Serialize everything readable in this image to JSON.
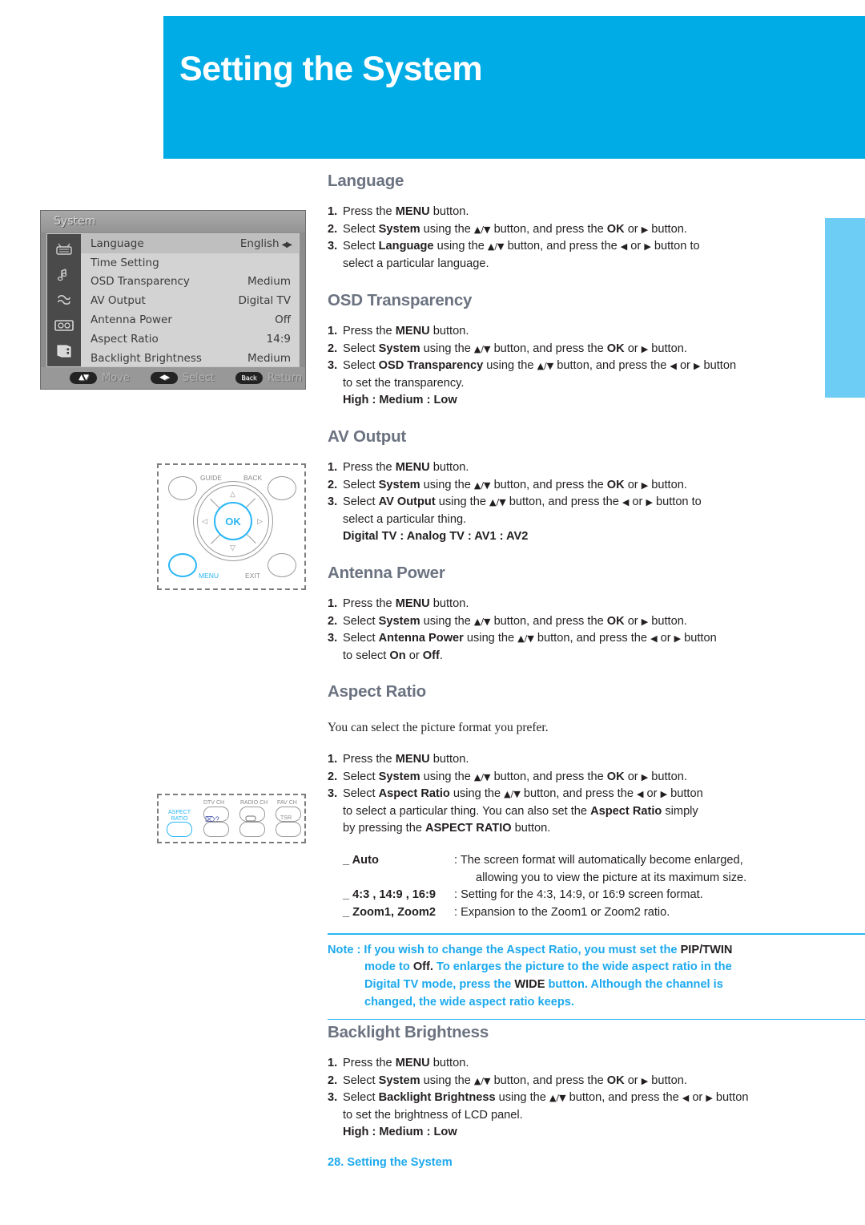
{
  "header": {
    "title": "Setting the System",
    "band_color": "#00ace6",
    "side_tab_color": "#6ecdf5"
  },
  "osd": {
    "title": "System",
    "icons": [
      "tv-icon",
      "music-note-icon",
      "sync-arrows-icon",
      "cassette-icon",
      "system-book-icon"
    ],
    "rows": [
      {
        "label": "Language",
        "value": "English",
        "selected": true,
        "has_arrows": true
      },
      {
        "label": "Time Setting",
        "value": "",
        "selected": false,
        "has_arrows": false
      },
      {
        "label": "OSD Transparency",
        "value": "Medium",
        "selected": false,
        "has_arrows": false
      },
      {
        "label": "AV Output",
        "value": "Digital TV",
        "selected": false,
        "has_arrows": false
      },
      {
        "label": "Antenna Power",
        "value": "Off",
        "selected": false,
        "has_arrows": false
      },
      {
        "label": "Aspect Ratio",
        "value": "14:9",
        "selected": false,
        "has_arrows": false
      },
      {
        "label": "Backlight Brightness",
        "value": "Medium",
        "selected": false,
        "has_arrows": false
      }
    ],
    "footer": [
      {
        "key": "▲▼",
        "label": "Move"
      },
      {
        "key": "◀▶",
        "label": "Select"
      },
      {
        "key": "Back",
        "label": "Return"
      }
    ]
  },
  "remote_dpad": {
    "guide_label": "GUIDE",
    "back_label": "BACK",
    "ok_label": "OK",
    "menu_label": "MENU",
    "exit_label": "EXIT",
    "highlight_color": "#29b6f6"
  },
  "remote_aspect": {
    "aspect_line1": "ASPECT",
    "aspect_line2": "RATIO",
    "dtv_ch_label": "DTV CH",
    "radio_ch_label": "RADIO CH",
    "fav_ch_label": "FAV CH",
    "mute_label": "⌦?",
    "tsr_label": "TSR",
    "highlight_color": "#29b6f6"
  },
  "sections": {
    "language": {
      "heading": "Language",
      "steps": [
        {
          "num": "1.",
          "html": "Press the <b>MENU</b> button."
        },
        {
          "num": "2.",
          "html": "Select <b>System</b> using the <span class=\"glyph\">▲/▼</span> button, and press the <b>OK</b> or <span class=\"glyph\">▶</span> button."
        },
        {
          "num": "3.",
          "html": "Select <b>Language</b> using the <span class=\"glyph\">▲/▼</span> button, and press the <span class=\"glyph\">◀</span> or <span class=\"glyph\">▶</span> button to<br>select a particular language."
        }
      ]
    },
    "osd_transparency": {
      "heading": "OSD Transparency",
      "steps": [
        {
          "num": "1.",
          "html": "Press the <b>MENU</b> button."
        },
        {
          "num": "2.",
          "html": "Select <b>System</b> using the <span class=\"glyph\">▲/▼</span> button, and press the <b>OK</b> or <span class=\"glyph\">▶</span> button."
        },
        {
          "num": "3.",
          "html": "Select <b>OSD Transparency</b> using the <span class=\"glyph\">▲/▼</span> button, and press the <span class=\"glyph\">◀</span> or <span class=\"glyph\">▶</span> button<br>to set the transparency."
        }
      ],
      "options": "High : Medium : Low"
    },
    "av_output": {
      "heading": "AV Output",
      "steps": [
        {
          "num": "1.",
          "html": "Press the <b>MENU</b> button."
        },
        {
          "num": "2.",
          "html": "Select <b>System</b> using the <span class=\"glyph\">▲/▼</span> button, and press the <b>OK</b> or <span class=\"glyph\">▶</span> button."
        },
        {
          "num": "3.",
          "html": "Select <b>AV Output</b> using the <span class=\"glyph\">▲/▼</span> button, and press the <span class=\"glyph\">◀</span> or <span class=\"glyph\">▶</span> button to<br>select a particular thing."
        }
      ],
      "options": "Digital TV : Analog TV : AV1 : AV2"
    },
    "antenna_power": {
      "heading": "Antenna Power",
      "steps": [
        {
          "num": "1.",
          "html": "Press the <b>MENU</b> button."
        },
        {
          "num": "2.",
          "html": "Select <b>System</b> using the <span class=\"glyph\">▲/▼</span> button, and press the <b>OK</b> or <span class=\"glyph\">▶</span> button."
        },
        {
          "num": "3.",
          "html": "Select <b>Antenna Power</b> using the <span class=\"glyph\">▲/▼</span> button, and press the <span class=\"glyph\">◀</span> or <span class=\"glyph\">▶</span> button<br>to select <b>On</b> or <b>Off</b>."
        }
      ]
    },
    "aspect_ratio": {
      "heading": "Aspect Ratio",
      "intro": "You can select the picture format you prefer.",
      "steps": [
        {
          "num": "1.",
          "html": "Press the <b>MENU</b> button."
        },
        {
          "num": "2.",
          "html": "Select <b>System</b> using the <span class=\"glyph\">▲/▼</span> button, and press the <b>OK</b> or <span class=\"glyph\">▶</span> button."
        },
        {
          "num": "3.",
          "html": "Select <b>Aspect Ratio</b> using the <span class=\"glyph\">▲/▼</span> button, and press the <span class=\"glyph\">◀</span> or <span class=\"glyph\">▶</span> button<br>to select a particular thing. You can also set the <b>Aspect Ratio</b> simply<br>by pressing the <b>ASPECT RATIO</b> button."
        }
      ],
      "definitions": [
        {
          "term": "_ Auto",
          "desc": ": The screen format will automatically become enlarged,",
          "cont": "allowing you to view the picture at its maximum size."
        },
        {
          "term": "_ 4:3 , 14:9 , 16:9",
          "desc": ": Setting for the 4:3, 14:9, or 16:9 screen format.",
          "cont": ""
        },
        {
          "term": "_ Zoom1, Zoom2",
          "desc": ": Expansion to the Zoom1 or Zoom2 ratio.",
          "cont": ""
        }
      ]
    },
    "note": {
      "lines": [
        "Note : If you wish to change the Aspect Ratio, you must set the <span class=\"dark\">PIP/TWIN</span>",
        "mode to <span class=\"dark\">Off.</span> To enlarges the picture to the wide aspect ratio in the",
        "Digital TV mode, press the <span class=\"dark\">WIDE</span> button. Although the channel is",
        "changed, the wide aspect ratio keeps."
      ],
      "color": "#1ca9ee"
    },
    "backlight_brightness": {
      "heading": "Backlight Brightness",
      "steps": [
        {
          "num": "1.",
          "html": "Press the <b>MENU</b> button."
        },
        {
          "num": "2.",
          "html": "Select <b>System</b> using the <span class=\"glyph\">▲/▼</span> button, and press the <b>OK</b> or <span class=\"glyph\">▶</span> button."
        },
        {
          "num": "3.",
          "html": "Select <b>Backlight Brightness</b> using the <span class=\"glyph\">▲/▼</span> button, and press the <span class=\"glyph\">◀</span> or <span class=\"glyph\">▶</span> button<br>to set the brightness of LCD panel."
        }
      ],
      "options": "High : Medium : Low"
    }
  },
  "footer": {
    "text": "28. Setting the System"
  }
}
